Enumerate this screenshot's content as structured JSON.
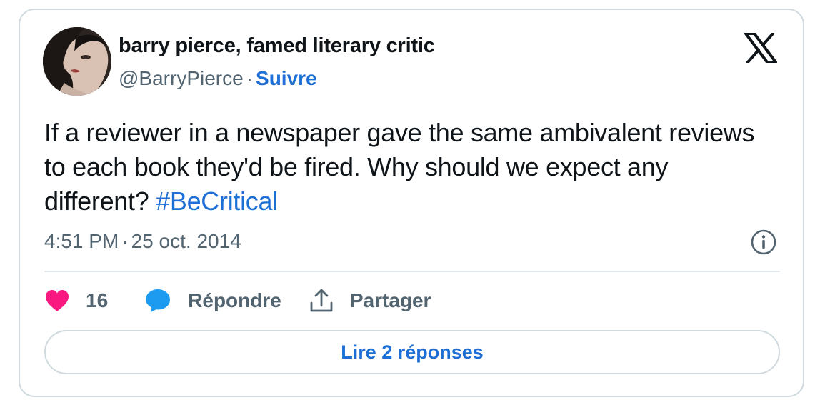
{
  "author": {
    "display_name": "barry pierce, famed literary critic",
    "handle": "@BarryPierce",
    "separator": "·",
    "follow_label": "Suivre"
  },
  "tweet": {
    "text": "If a reviewer in a newspaper gave the same ambivalent reviews to each book they'd be fired. Why should we expect any different? ",
    "hashtag": "#BeCritical",
    "time": "4:51 PM",
    "date": "25 oct. 2014",
    "separator": "·"
  },
  "actions": {
    "like_count": "16",
    "reply_label": "Répondre",
    "share_label": "Partager"
  },
  "read_replies_label": "Lire 2 réponses",
  "icons": {
    "logo": "x-logo-icon",
    "info": "info-icon",
    "like": "heart-icon",
    "reply": "speech-bubble-icon",
    "share": "share-upload-icon"
  },
  "colors": {
    "link_blue": "#1d6fd6",
    "heart_pink": "#f91880",
    "reply_blue": "#1d9bf0",
    "text_primary": "#0f1419",
    "text_secondary": "#536471",
    "border": "#cfd9de"
  }
}
